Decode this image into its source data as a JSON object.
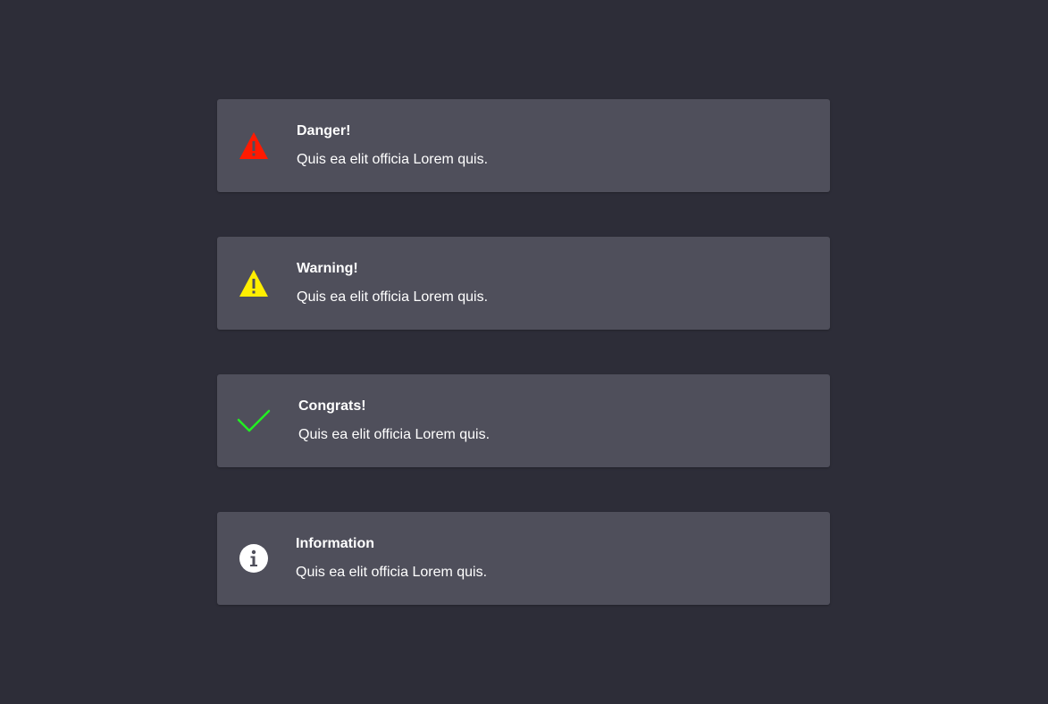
{
  "alerts": [
    {
      "kind": "danger",
      "icon": "danger-triangle-icon",
      "color": "#ff1a00",
      "title": "Danger!",
      "message": "Quis ea elit officia Lorem quis."
    },
    {
      "kind": "warning",
      "icon": "warning-triangle-icon",
      "color": "#ffee00",
      "title": "Warning!",
      "message": "Quis ea elit officia Lorem quis."
    },
    {
      "kind": "success",
      "icon": "check-icon",
      "color": "#22ee22",
      "title": "Congrats!",
      "message": "Quis ea elit officia Lorem quis."
    },
    {
      "kind": "info",
      "icon": "info-icon",
      "color": "#ffffff",
      "title": "Information",
      "message": "Quis ea elit officia Lorem quis."
    }
  ]
}
